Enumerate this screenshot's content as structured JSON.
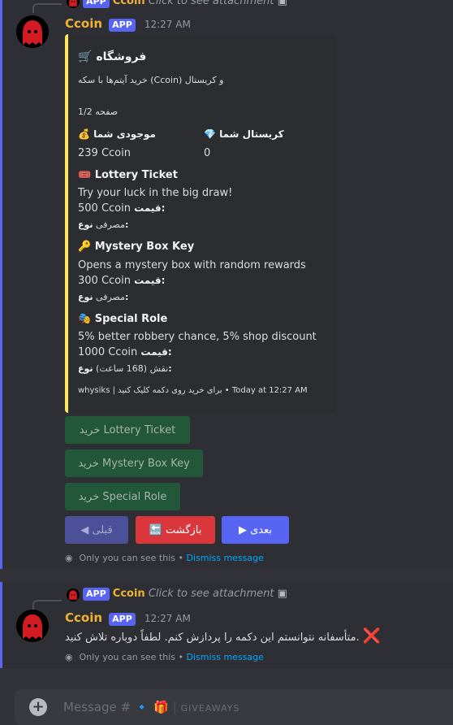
{
  "colors": {
    "accent": "#5865f2",
    "embed_bar": "#fee75c",
    "username": "#f0b232",
    "link": "#00a8fc"
  },
  "msg1": {
    "reply": {
      "author": "Ccoin",
      "tag": "APP",
      "text": "Click to see attachment"
    },
    "author": "Ccoin",
    "tag": "APP",
    "time": "12:27 AM",
    "embed": {
      "title": "🛒 فروشگاه",
      "description": "خرید آیتم‌ها با سکه (Ccoin) و کریستال",
      "page": "صفحه 1/2",
      "fields": {
        "coins_label": "💰 موجودی شما",
        "coins_value": "239 Ccoin",
        "crystal_label": "💎 کریستال شما",
        "crystal_value": "0"
      },
      "items": [
        {
          "icon": "🎟️",
          "name": "Lottery Ticket",
          "desc": "Try your luck in the big draw!",
          "price_label": "قیمت:",
          "price": "500 Ccoin",
          "type_label": "نوع:",
          "type": "مصرفی"
        },
        {
          "icon": "🔑",
          "name": "Mystery Box Key",
          "desc": "Opens a mystery box with random rewards",
          "price_label": "قیمت:",
          "price": "300 Ccoin",
          "type_label": "نوع:",
          "type": "مصرفی"
        },
        {
          "icon": "🎭",
          "name": "Special Role",
          "desc": "5% better robbery chance, 5% shop discount",
          "price_label": "قیمت:",
          "price": "1000 Ccoin",
          "type_label": "نوع:",
          "type": "نقش (168 ساعت)"
        }
      ],
      "footer": "whysiks | برای خرید روی دکمه کلیک کنید • Today at 12:27 AM"
    },
    "buttons": {
      "buy1": "خرید Lottery Ticket",
      "buy2": "خرید Mystery Box Key",
      "buy3": "خرید Special Role",
      "prev": "◀ قبلی",
      "back": "🔙 بازگشت",
      "next": "▶ بعدی"
    },
    "ephemeral": {
      "text": "Only you can see this •",
      "link": "Dismiss message"
    }
  },
  "msg2": {
    "reply": {
      "author": "Ccoin",
      "tag": "APP",
      "text": "Click to see attachment"
    },
    "author": "Ccoin",
    "tag": "APP",
    "time": "12:27 AM",
    "error_icon": "❌",
    "text": "متأسفانه نتوانستم این دکمه را پردازش کنم. لطفاً دوباره تلاش کنید.",
    "ephemeral": {
      "text": "Only you can see this •",
      "link": "Dismiss message"
    }
  },
  "input": {
    "placeholder": "Message #",
    "channel_icons": "🔹 🎁",
    "channel": "GIVEAWAYS"
  }
}
